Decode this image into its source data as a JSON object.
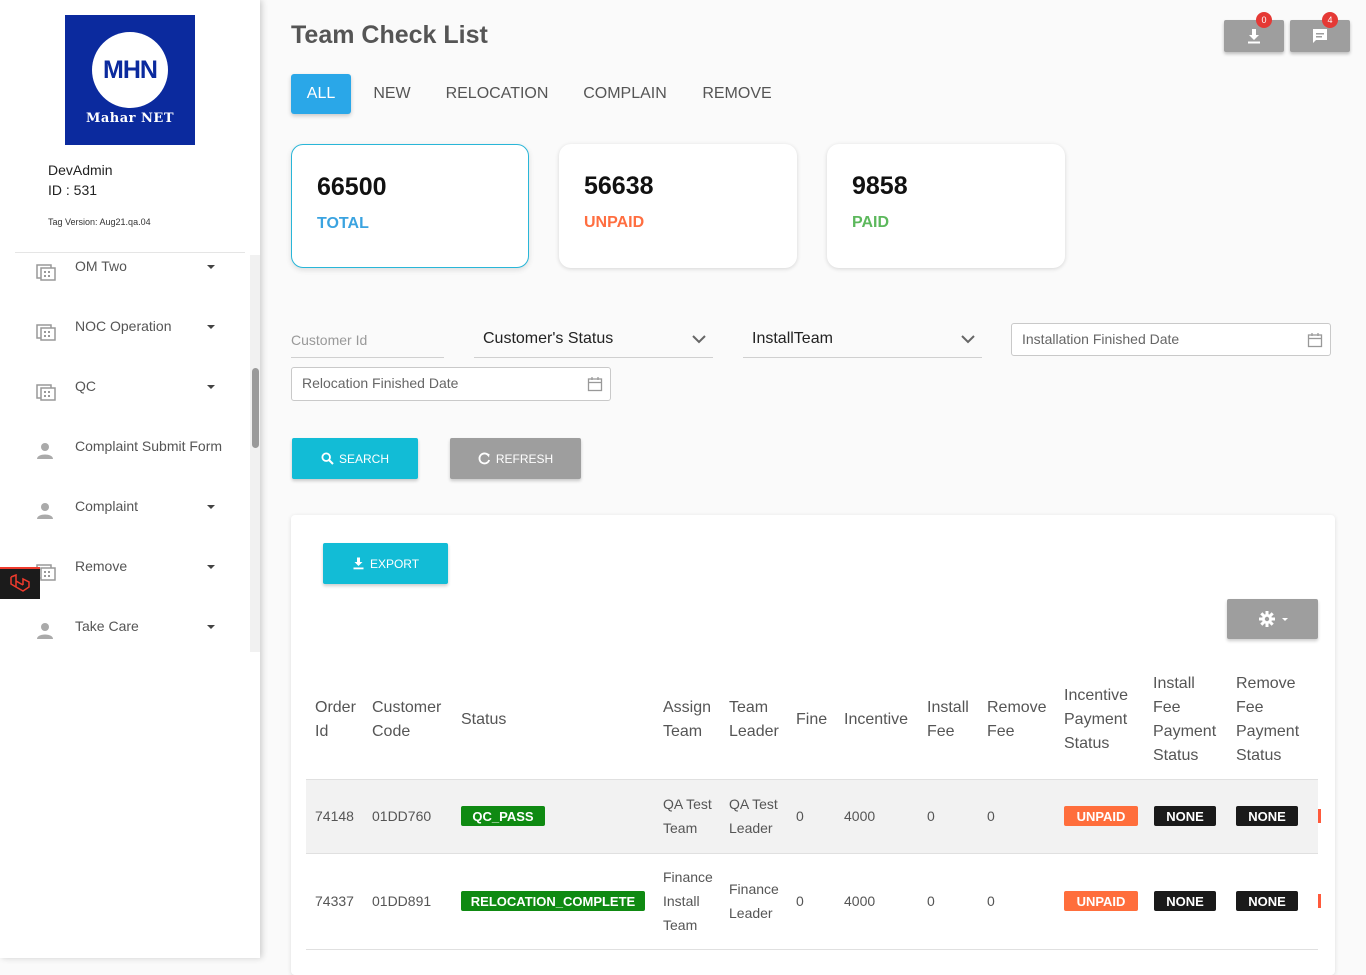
{
  "sidebar": {
    "logo": {
      "mark": "MHN",
      "name": "Mahar NET"
    },
    "user_name": "DevAdmin",
    "user_id": "ID : 531",
    "tag_version": "Tag Version: Aug21.qa.04",
    "items": [
      {
        "label": "OM Two",
        "icon": "building-icon",
        "has_caret": true
      },
      {
        "label": "NOC Operation",
        "icon": "building-icon",
        "has_caret": true
      },
      {
        "label": "QC",
        "icon": "building-icon",
        "has_caret": true
      },
      {
        "label": "Complaint Submit Form",
        "icon": "person-icon",
        "has_caret": false
      },
      {
        "label": "Complaint",
        "icon": "person-icon",
        "has_caret": true
      },
      {
        "label": "Remove",
        "icon": "building-icon",
        "has_caret": true
      },
      {
        "label": "Take Care",
        "icon": "person-icon",
        "has_caret": true
      }
    ]
  },
  "header": {
    "title": "Team Check List",
    "download_badge": "0",
    "message_badge": "4"
  },
  "tabs": [
    {
      "label": "ALL",
      "active": true
    },
    {
      "label": "NEW",
      "active": false
    },
    {
      "label": "RELOCATION",
      "active": false
    },
    {
      "label": "COMPLAIN",
      "active": false
    },
    {
      "label": "REMOVE",
      "active": false
    }
  ],
  "stats": [
    {
      "value": "66500",
      "label": "TOTAL",
      "color": "#3aa3e0"
    },
    {
      "value": "56638",
      "label": "UNPAID",
      "color": "#ff6e40"
    },
    {
      "value": "9858",
      "label": "PAID",
      "color": "#5cb85c"
    }
  ],
  "filters": {
    "customer_id_placeholder": "Customer Id",
    "customer_status": "Customer's Status",
    "install_team": "InstallTeam",
    "installation_finished_date": "Installation Finished Date",
    "relocation_finished_date": "Relocation Finished Date"
  },
  "buttons": {
    "search": "SEARCH",
    "refresh": "REFRESH",
    "export": "EXPORT"
  },
  "table": {
    "headers": [
      [
        "Order",
        "Id"
      ],
      [
        "Customer",
        "Code"
      ],
      [
        "Status"
      ],
      [
        "Assign",
        "Team"
      ],
      [
        "Team",
        "Leader"
      ],
      [
        "Fine"
      ],
      [
        "Incentive"
      ],
      [
        "Install",
        "Fee"
      ],
      [
        "Remove",
        "Fee"
      ],
      [
        "Incentive",
        "Payment",
        "Status"
      ],
      [
        "Install",
        "Fee",
        "Payment",
        "Status"
      ],
      [
        "Remove",
        "Fee",
        "Payment",
        "Status"
      ]
    ],
    "rows": [
      {
        "order_id": "74148",
        "customer_code": "01DD760",
        "status": "QC_PASS",
        "assign_team": [
          "QA Test",
          "Team"
        ],
        "team_leader": [
          "QA Test",
          "Leader"
        ],
        "fine": "0",
        "incentive": "4000",
        "install_fee": "0",
        "remove_fee": "0",
        "incentive_payment_status": "UNPAID",
        "install_fee_payment_status": "NONE",
        "remove_fee_payment_status": "NONE"
      },
      {
        "order_id": "74337",
        "customer_code": "01DD891",
        "status": "RELOCATION_COMPLETE",
        "assign_team": [
          "Finance",
          "Install",
          "Team"
        ],
        "team_leader": [
          "Finance",
          "Leader"
        ],
        "fine": "0",
        "incentive": "4000",
        "install_fee": "0",
        "remove_fee": "0",
        "incentive_payment_status": "UNPAID",
        "install_fee_payment_status": "NONE",
        "remove_fee_payment_status": "NONE"
      }
    ]
  },
  "colors": {
    "accent_blue": "#2aa7e8",
    "cyan": "#12bcd6",
    "grey_button": "#9e9e9e",
    "status_green": "#0f8a12",
    "unpaid_orange": "#ff6e3c",
    "none_dark": "#1a1a1a"
  }
}
